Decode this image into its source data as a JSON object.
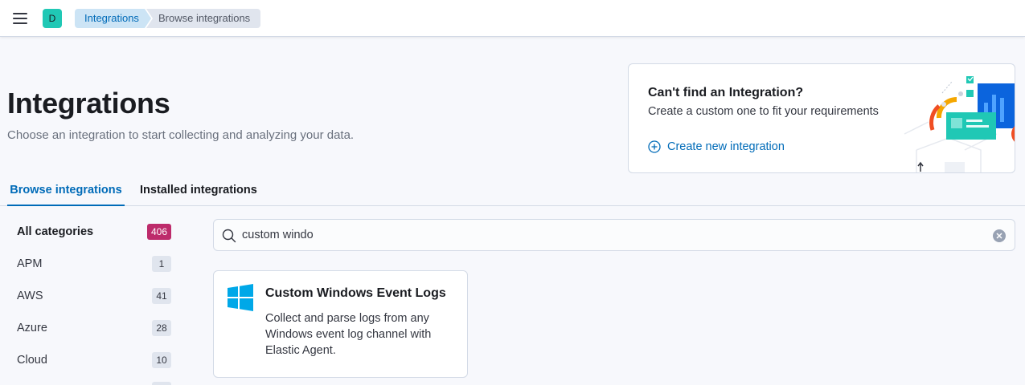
{
  "header": {
    "space_initial": "D",
    "breadcrumbs": [
      "Integrations",
      "Browse integrations"
    ]
  },
  "page": {
    "title": "Integrations",
    "description": "Choose an integration to start collecting and analyzing your data."
  },
  "promo": {
    "title": "Can't find an Integration?",
    "subtitle": "Create a custom one to fit your requirements",
    "link_label": "Create new integration"
  },
  "tabs": [
    {
      "label": "Browse integrations",
      "active": true
    },
    {
      "label": "Installed integrations",
      "active": false
    }
  ],
  "categories": [
    {
      "label": "All categories",
      "count": "406",
      "active": true
    },
    {
      "label": "APM",
      "count": "1",
      "active": false
    },
    {
      "label": "AWS",
      "count": "41",
      "active": false
    },
    {
      "label": "Azure",
      "count": "28",
      "active": false
    },
    {
      "label": "Cloud",
      "count": "10",
      "active": false
    }
  ],
  "search": {
    "value": "custom windo"
  },
  "results": [
    {
      "icon": "windows-logo-icon",
      "title": "Custom Windows Event Logs",
      "description": "Collect and parse logs from any Windows event log channel with Elastic Agent."
    }
  ],
  "colors": {
    "accent": "#006bb8",
    "badge_active": "#bd2b6b",
    "windows_blue": "#00a8e8",
    "avatar": "#20c8b5"
  }
}
